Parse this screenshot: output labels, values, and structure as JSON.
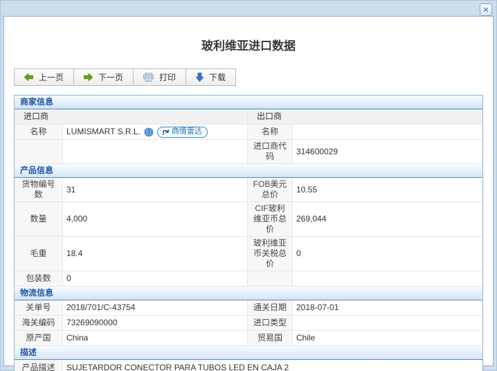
{
  "dialog": {
    "title": "玻利维亚进口数据",
    "close_glyph": "✕"
  },
  "toolbar": {
    "prev_label": "上一页",
    "next_label": "下一页",
    "print_label": "打印",
    "download_label": "下载"
  },
  "colors": {
    "accent_blue": "#2155a3",
    "badge_blue": "#1c74b4",
    "arrow_green": "#63a417",
    "arrow_down_blue": "#3a6fd0",
    "table_border": "#8db2d5",
    "dialog_frame": "#cfdce9"
  },
  "icons": {
    "close": "close-icon",
    "prev": "arrow-left-icon",
    "next": "arrow-right-icon",
    "print": "printer-icon",
    "download": "arrow-down-icon",
    "globe": "globe-icon",
    "radar": "radar-icon"
  },
  "merchant": {
    "title": "商家信息",
    "importer_header": "进口商",
    "exporter_header": "出口商",
    "name_label_left": "名称",
    "importer_name": "LUMISMART S.R.L.",
    "radar_badge_label": "商情雷达",
    "name_label_right": "名称",
    "exporter_name": "",
    "importer_code_label": "进口商代码",
    "importer_code_value": "314600029"
  },
  "product": {
    "title": "产品信息",
    "rows": [
      {
        "l1": "货物编号数",
        "v1": "31",
        "l2": "FOB美元总价",
        "v2": "10.55"
      },
      {
        "l1": "数量",
        "v1": "4,000",
        "l2": "CIF玻利维亚币总价",
        "v2": "269,044"
      },
      {
        "l1": "毛重",
        "v1": "18.4",
        "l2": "玻利维亚币关税总价",
        "v2": "0"
      },
      {
        "l1": "包装数",
        "v1": "0",
        "l2": "",
        "v2": ""
      }
    ]
  },
  "logistics": {
    "title": "物流信息",
    "rows": [
      {
        "l1": "关单号",
        "v1": "2018/701/C-43754",
        "l2": "通关日期",
        "v2": "2018-07-01"
      },
      {
        "l1": "海关编码",
        "v1": "73269090000",
        "l2": "进口类型",
        "v2": ""
      },
      {
        "l1": "原产国",
        "v1": "China",
        "l2": "贸易国",
        "v2": "Chile"
      }
    ]
  },
  "description": {
    "title": "描述",
    "label": "产品描述",
    "value": "SUJETARDOR CONECTOR PARA TUBOS LED EN CAJA 2"
  }
}
